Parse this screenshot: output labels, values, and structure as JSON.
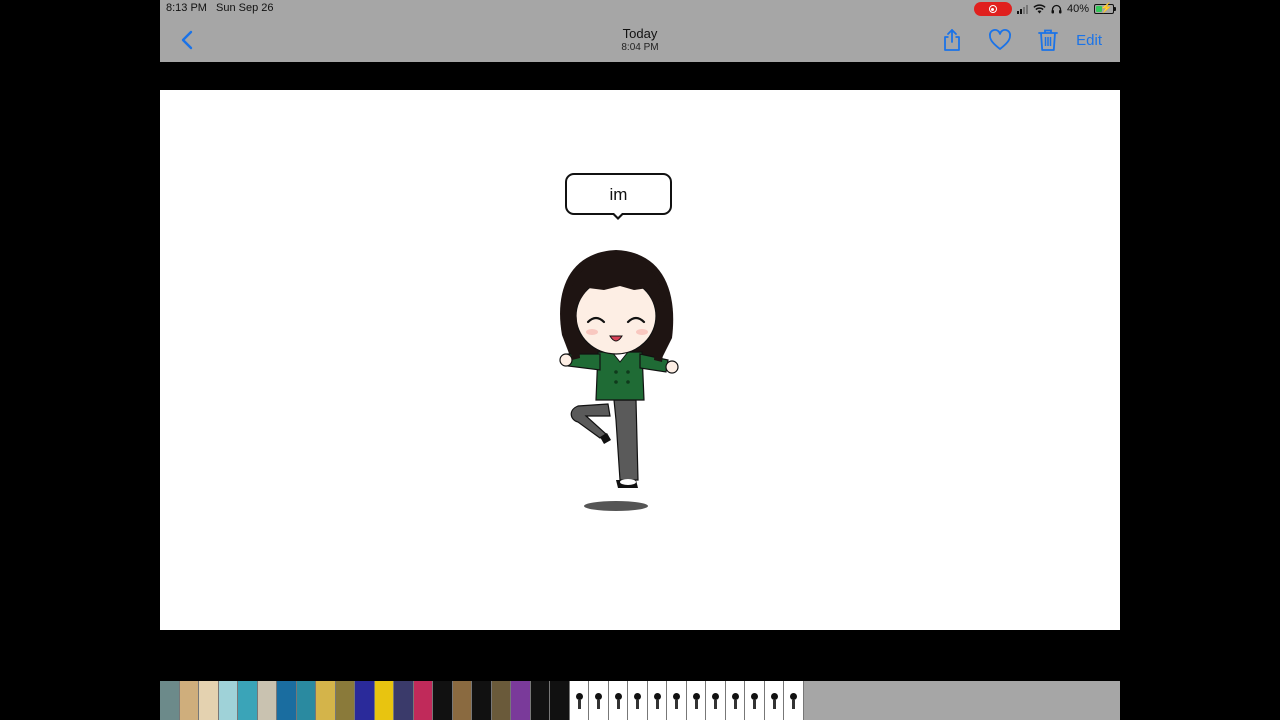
{
  "status_bar": {
    "time": "8:13 PM",
    "date": "Sun Sep 26",
    "battery": "40%",
    "battery_level": 0.4
  },
  "nav": {
    "title": "Today",
    "subtitle": "8:04 PM",
    "edit_label": "Edit",
    "icons": [
      "back-chevron-icon",
      "share-icon",
      "heart-icon",
      "trash-icon"
    ],
    "accent_color": "#1a73e8"
  },
  "photo": {
    "speech_text": "im",
    "character": {
      "hair_color": "#1e1412",
      "shirt_color": "#1f6b35",
      "pants_color": "#5a5a5a",
      "skin_color": "#fdeee4"
    }
  },
  "thumbnail_strip": {
    "colors": [
      "#6c8a8a",
      "#cfae7c",
      "#e4d2b0",
      "#9fd2d8",
      "#3aa4b8",
      "#c9c2b0",
      "#1a6da0",
      "#2a8aa0",
      "#d4b44a",
      "#8a7a3a",
      "#2a2a9a",
      "#e8c410",
      "#3a3a6a",
      "#c02a5a",
      "#111111",
      "#8a6a40",
      "#111111",
      "#6a5a3a",
      "#7a3a9a",
      "#111111",
      "#111111",
      "#ffffff",
      "#ffffff",
      "#ffffff",
      "#ffffff",
      "#ffffff",
      "#ffffff",
      "#ffffff",
      "#ffffff",
      "#ffffff",
      "#ffffff",
      "#ffffff",
      "#ffffff"
    ]
  }
}
